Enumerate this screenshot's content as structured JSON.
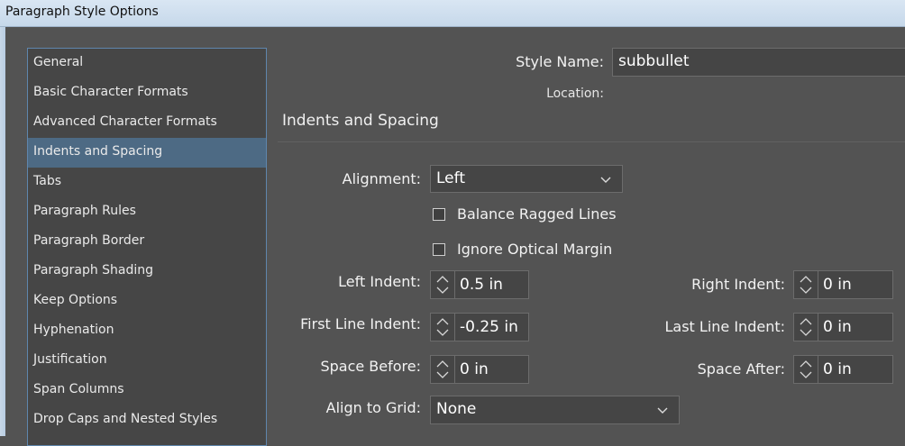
{
  "window": {
    "title": "Paragraph Style Options"
  },
  "categories": [
    {
      "label": "General",
      "selected": false
    },
    {
      "label": "Basic Character Formats",
      "selected": false
    },
    {
      "label": "Advanced Character Formats",
      "selected": false
    },
    {
      "label": "Indents and Spacing",
      "selected": true
    },
    {
      "label": "Tabs",
      "selected": false
    },
    {
      "label": "Paragraph Rules",
      "selected": false
    },
    {
      "label": "Paragraph Border",
      "selected": false
    },
    {
      "label": "Paragraph Shading",
      "selected": false
    },
    {
      "label": "Keep Options",
      "selected": false
    },
    {
      "label": "Hyphenation",
      "selected": false
    },
    {
      "label": "Justification",
      "selected": false
    },
    {
      "label": "Span Columns",
      "selected": false
    },
    {
      "label": "Drop Caps and Nested Styles",
      "selected": false
    }
  ],
  "style_name": {
    "label": "Style Name:",
    "value": "subbullet"
  },
  "location": {
    "label": "Location:"
  },
  "section": {
    "title": "Indents and Spacing"
  },
  "alignment": {
    "label": "Alignment:",
    "value": "Left"
  },
  "balance_ragged": {
    "label": "Balance Ragged Lines",
    "checked": false
  },
  "ignore_optical": {
    "label": "Ignore Optical Margin",
    "checked": false
  },
  "left_indent": {
    "label": "Left Indent:",
    "value": "0.5 in"
  },
  "right_indent": {
    "label": "Right Indent:",
    "value": "0 in"
  },
  "first_line_indent": {
    "label": "First Line Indent:",
    "value": "-0.25 in"
  },
  "last_line_indent": {
    "label": "Last Line Indent:",
    "value": "0 in"
  },
  "space_before": {
    "label": "Space Before:",
    "value": "0 in"
  },
  "space_after": {
    "label": "Space After:",
    "value": "0 in"
  },
  "align_to_grid": {
    "label": "Align to Grid:",
    "value": "None"
  },
  "colors": {
    "background": "#535353",
    "list_bg": "#464646",
    "selected": "#4d6a84",
    "field_bg": "#454545"
  }
}
